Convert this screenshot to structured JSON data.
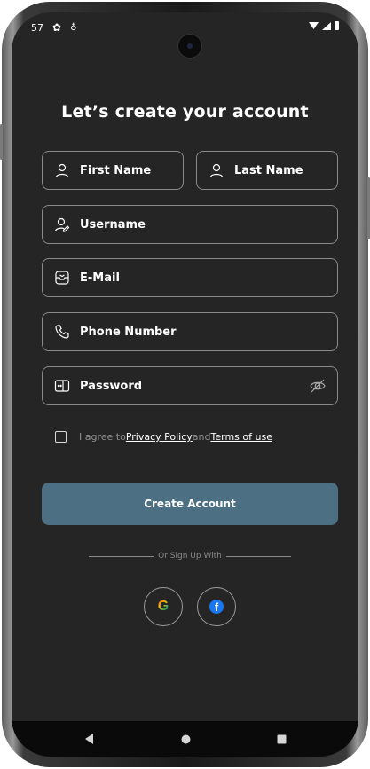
{
  "status_bar": {
    "time": "57"
  },
  "page": {
    "title": "Let’s create your account"
  },
  "form": {
    "first_name": "First Name",
    "last_name": "Last Name",
    "username": "Username",
    "email": "E-Mail",
    "phone": "Phone Number",
    "password": "Password"
  },
  "terms": {
    "prefix": "I agree to ",
    "privacy_link": "Privacy Policy",
    "middle": "and ",
    "terms_link": "Terms of use",
    "checked": false
  },
  "actions": {
    "create_account": "Create Account",
    "divider_text": "Or Sign Up With"
  },
  "social": {
    "google": "G",
    "facebook": "f"
  },
  "colors": {
    "background": "#252525",
    "accent_button": "#4d6f84",
    "border": "#8a8a8a",
    "facebook_blue": "#1877f2"
  }
}
